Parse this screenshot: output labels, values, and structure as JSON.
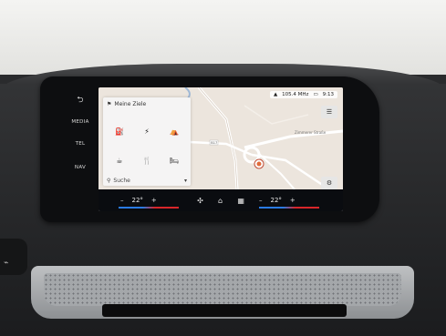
{
  "hardkeys": {
    "back_icon": "back-arrow-icon",
    "media": "MEDIA",
    "tel": "TEL",
    "nav": "NAV"
  },
  "status": {
    "signal": "signal-icon",
    "station": "105.4 MHz",
    "time": "9:13"
  },
  "map": {
    "street_label": "Zimmerer Straße",
    "road_number": "B17"
  },
  "panel": {
    "title": "Meine Ziele",
    "search_placeholder": "Suche",
    "tiles": [
      {
        "icon": "fuel-pump-icon",
        "glyph": "⛽"
      },
      {
        "icon": "ev-charging-icon",
        "glyph": "⚡"
      },
      {
        "icon": "picnic-table-icon",
        "glyph": "⛺"
      },
      {
        "icon": "coffee-cup-icon",
        "glyph": "☕"
      },
      {
        "icon": "restaurant-icon",
        "glyph": "🍴"
      },
      {
        "icon": "hotel-bed-icon",
        "glyph": "🛏"
      }
    ]
  },
  "climate": {
    "left_temp": "22°",
    "right_temp": "22°",
    "minus": "–",
    "plus": "+",
    "icons": [
      "fan-icon",
      "home-icon",
      "apps-grid-icon"
    ]
  },
  "colors": {
    "accent_blue": "#2a7be4",
    "accent_red": "#d8262a"
  }
}
